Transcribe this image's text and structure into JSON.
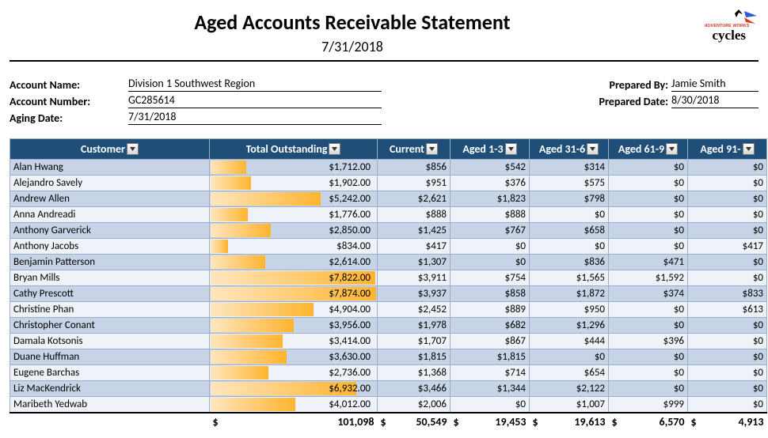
{
  "header": {
    "title": "Aged Accounts Receivable Statement",
    "date": "7/31/2018",
    "logo_text1": "ADVENTURE WORKS",
    "logo_text2": "cycles"
  },
  "meta": {
    "account_name_label": "Account Name:",
    "account_name": "Division 1 Southwest Region",
    "account_number_label": "Account Number:",
    "account_number": "GC285614",
    "aging_date_label": "Aging Date:",
    "aging_date": "7/31/2018",
    "prepared_by_label": "Prepared By:",
    "prepared_by": "Jamie Smith",
    "prepared_date_label": "Prepared Date:",
    "prepared_date": "8/30/2018"
  },
  "columns": {
    "customer": "Customer",
    "total": "Total Outstanding",
    "current": "Current",
    "a1": "Aged 1-3",
    "a31": "Aged 31-6",
    "a61": "Aged 61-9",
    "a91": "Aged 91-"
  },
  "max_total": 7874,
  "rows": [
    {
      "customer": "Alan Hwang",
      "total": "$1,712.00",
      "tval": 1712,
      "current": "$856",
      "a1": "$542",
      "a31": "$314",
      "a61": "$0",
      "a91": "$0"
    },
    {
      "customer": "Alejandro Savely",
      "total": "$1,902.00",
      "tval": 1902,
      "current": "$951",
      "a1": "$376",
      "a31": "$575",
      "a61": "$0",
      "a91": "$0"
    },
    {
      "customer": "Andrew Allen",
      "total": "$5,242.00",
      "tval": 5242,
      "current": "$2,621",
      "a1": "$1,823",
      "a31": "$798",
      "a61": "$0",
      "a91": "$0"
    },
    {
      "customer": "Anna Andreadi",
      "total": "$1,776.00",
      "tval": 1776,
      "current": "$888",
      "a1": "$888",
      "a31": "$0",
      "a61": "$0",
      "a91": "$0"
    },
    {
      "customer": "Anthony Garverick",
      "total": "$2,850.00",
      "tval": 2850,
      "current": "$1,425",
      "a1": "$767",
      "a31": "$658",
      "a61": "$0",
      "a91": "$0"
    },
    {
      "customer": "Anthony Jacobs",
      "total": "$834.00",
      "tval": 834,
      "current": "$417",
      "a1": "$0",
      "a31": "$0",
      "a61": "$0",
      "a91": "$417"
    },
    {
      "customer": "Benjamin Patterson",
      "total": "$2,614.00",
      "tval": 2614,
      "current": "$1,307",
      "a1": "$0",
      "a31": "$836",
      "a61": "$471",
      "a91": "$0"
    },
    {
      "customer": "Bryan Mills",
      "total": "$7,822.00",
      "tval": 7822,
      "current": "$3,911",
      "a1": "$754",
      "a31": "$1,565",
      "a61": "$1,592",
      "a91": "$0"
    },
    {
      "customer": "Cathy Prescott",
      "total": "$7,874.00",
      "tval": 7874,
      "current": "$3,937",
      "a1": "$858",
      "a31": "$1,872",
      "a61": "$374",
      "a91": "$833"
    },
    {
      "customer": "Christine Phan",
      "total": "$4,904.00",
      "tval": 4904,
      "current": "$2,452",
      "a1": "$889",
      "a31": "$950",
      "a61": "$0",
      "a91": "$613"
    },
    {
      "customer": "Christopher Conant",
      "total": "$3,956.00",
      "tval": 3956,
      "current": "$1,978",
      "a1": "$682",
      "a31": "$1,296",
      "a61": "$0",
      "a91": "$0"
    },
    {
      "customer": "Damala Kotsonis",
      "total": "$3,414.00",
      "tval": 3414,
      "current": "$1,707",
      "a1": "$867",
      "a31": "$444",
      "a61": "$396",
      "a91": "$0"
    },
    {
      "customer": "Duane Huffman",
      "total": "$3,630.00",
      "tval": 3630,
      "current": "$1,815",
      "a1": "$1,815",
      "a31": "$0",
      "a61": "$0",
      "a91": "$0"
    },
    {
      "customer": "Eugene Barchas",
      "total": "$2,736.00",
      "tval": 2736,
      "current": "$1,368",
      "a1": "$714",
      "a31": "$654",
      "a61": "$0",
      "a91": "$0"
    },
    {
      "customer": "Liz MacKendrick",
      "total": "$6,932.00",
      "tval": 6932,
      "current": "$3,466",
      "a1": "$1,344",
      "a31": "$2,122",
      "a61": "$0",
      "a91": "$0"
    },
    {
      "customer": "Maribeth Yedwab",
      "total": "$4,012.00",
      "tval": 4012,
      "current": "$2,006",
      "a1": "$0",
      "a31": "$1,007",
      "a61": "$999",
      "a91": "$0"
    }
  ],
  "totals": {
    "sym": "$",
    "total": "101,098",
    "current": "50,549",
    "a1": "19,453",
    "a31": "19,613",
    "a61": "6,570",
    "a91": "4,913"
  }
}
